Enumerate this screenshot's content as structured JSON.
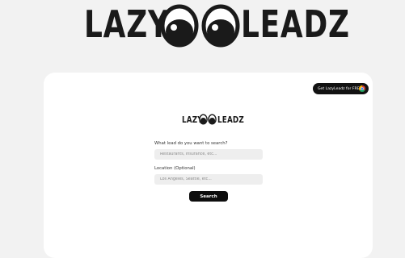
{
  "brand": {
    "word_left": "LAZY",
    "word_right": "LEADZ",
    "color": "#1a1a1a"
  },
  "cta": {
    "label": "Get LazyLeadz for FREE",
    "icon": "chrome-icon",
    "background": "#121212"
  },
  "form": {
    "lead_label": "What lead do you want to search?",
    "lead_placeholder": "Restaurants, Insurance, etc...",
    "location_label": "Location (Optional)",
    "location_placeholder": "Los Angeles, Seattle, etc...",
    "search_label": "Search"
  },
  "colors": {
    "page_background": "#f2f2f2",
    "card_background": "#ffffff",
    "input_background": "#eeeeee",
    "button_background": "#0d0d0d"
  }
}
